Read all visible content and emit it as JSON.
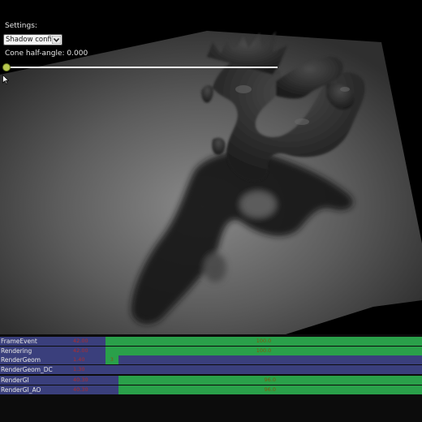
{
  "settings": {
    "title": "Settings:",
    "config_select": {
      "value": "Shadow config"
    },
    "cone_label": "Cone half-angle: 0.000",
    "cone_slider": {
      "value": 0.0
    }
  },
  "profiler": {
    "rows": [
      {
        "name": "FrameEvent",
        "ms": "42.00",
        "start": 0.0,
        "fraction": 1.0,
        "pct": "100.0"
      },
      {
        "name": "Rendering",
        "ms": "42.00",
        "start": 0.0,
        "fraction": 1.0,
        "pct": "100.0"
      },
      {
        "name": "RenderGeom",
        "ms": "1.40",
        "start": 0.0,
        "fraction": 0.04,
        "pct": "3"
      },
      {
        "name": "RenderGeom_DC",
        "ms": "1.30",
        "start": 0.0,
        "fraction": 0.0,
        "pct": ""
      },
      {
        "name": "RenderGI",
        "ms": "40.30",
        "start": 0.04,
        "fraction": 0.96,
        "pct": "96.0"
      },
      {
        "name": "RenderGI_AO",
        "ms": "40.30",
        "start": 0.04,
        "fraction": 0.96,
        "pct": "96.0"
      }
    ],
    "colors": {
      "bar": "#2aa04a",
      "row": "#3a3f7c"
    }
  }
}
